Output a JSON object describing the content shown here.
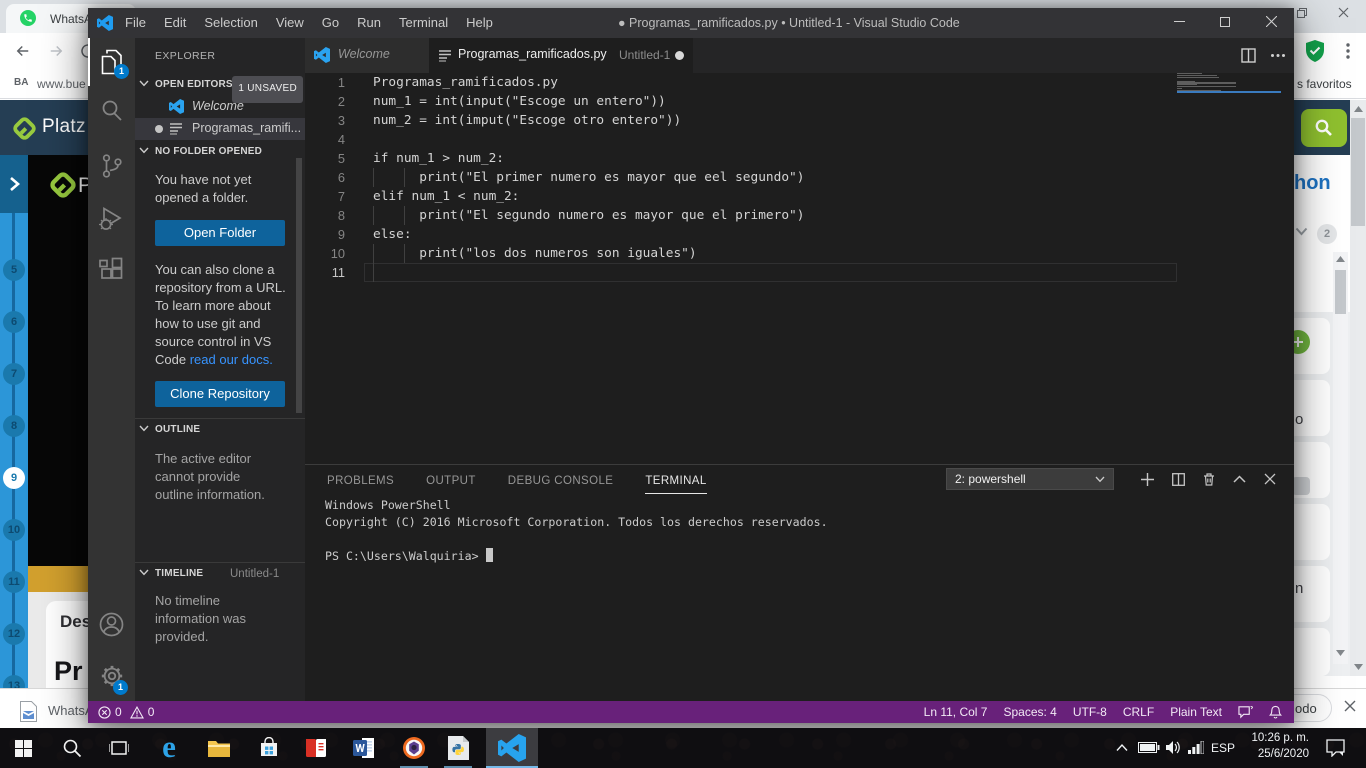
{
  "browser": {
    "tab_title": "WhatsA",
    "bookmark_item": "www.bue",
    "bookmark_right": "s favoritos",
    "brand": "Platz",
    "video_brand_letter": "P",
    "heading_fragment": "hon",
    "collapsed_count_badge": "2",
    "steps": [
      "5",
      "6",
      "7",
      "8",
      "9",
      "10",
      "11",
      "12",
      "13"
    ],
    "active_step": "9",
    "card_kicker_fragment": "Des",
    "card_title_fragment": "Pr",
    "list_fragment_1": "o",
    "list_fragment_2": "n",
    "shelf_item_label": "WhatsA",
    "shelf_button_fragment": "odo"
  },
  "vscode": {
    "title": "Programas_ramificados.py • Untitled-1 - Visual Studio Code",
    "dirty_dot": "●",
    "menu": [
      "File",
      "Edit",
      "Selection",
      "View",
      "Go",
      "Run",
      "Terminal",
      "Help"
    ],
    "tabs": {
      "welcome_label": "Welcome",
      "file_label": "Programas_ramificados.py",
      "file_description": "Untitled-1"
    },
    "explorer": {
      "title": "EXPLORER",
      "open_editors_label": "OPEN EDITORS",
      "open_editors_badge": "1 UNSAVED",
      "item_welcome": "Welcome",
      "item_file": "Programas_ramifi...",
      "no_folder_label": "NO FOLDER OPENED",
      "no_folder_text": "You have not yet opened a folder.",
      "open_folder_button": "Open Folder",
      "clone_text": "You can also clone a repository from a URL. To learn more about how to use git and source control in VS Code ",
      "clone_link": "read our docs.",
      "clone_button": "Clone Repository",
      "outline_label": "OUTLINE",
      "outline_text": "The active editor cannot provide outline information.",
      "timeline_label": "TIMELINE",
      "timeline_desc": "Untitled-1",
      "timeline_text": "No timeline information was provided."
    },
    "editor": {
      "lines": [
        {
          "n": "1",
          "text": "Programas_ramificados.py"
        },
        {
          "n": "2",
          "text": "num_1 = int(input(\"Escoge un entero\"))"
        },
        {
          "n": "3",
          "text": "num_2 = int(imput(\"Escoge otro entero\"))"
        },
        {
          "n": "4",
          "text": ""
        },
        {
          "n": "5",
          "text": "if num_1 > num_2:"
        },
        {
          "n": "6",
          "text": "      print(\"El primer numero es mayor que eel segundo\")",
          "guides": [
            0,
            4
          ]
        },
        {
          "n": "7",
          "text": "elif num_1 < num_2:"
        },
        {
          "n": "8",
          "text": "      print(\"El segundo numero es mayor que el primero\")",
          "guides": [
            0,
            4
          ]
        },
        {
          "n": "9",
          "text": "else:"
        },
        {
          "n": "10",
          "text": "      print(\"los dos numeros son iguales\")",
          "guides": [
            0,
            4
          ]
        },
        {
          "n": "11",
          "text": "",
          "guides": [
            0
          ],
          "current": true
        }
      ]
    },
    "panel": {
      "tabs": [
        "PROBLEMS",
        "OUTPUT",
        "DEBUG CONSOLE",
        "TERMINAL"
      ],
      "active_tab": "TERMINAL",
      "terminal_select": "2: powershell",
      "terminal_lines": [
        "Windows PowerShell",
        "Copyright (C) 2016 Microsoft Corporation. Todos los derechos reservados.",
        "",
        "PS C:\\Users\\Walquiria> "
      ]
    },
    "status": {
      "errors": "0",
      "warnings": "0",
      "items": [
        "Ln 11, Col 7",
        "Spaces: 4",
        "UTF-8",
        "CRLF",
        "Plain Text"
      ]
    }
  },
  "taskbar": {
    "language": "ESP",
    "time": "10:26 p. m.",
    "date": "25/6/2020"
  }
}
